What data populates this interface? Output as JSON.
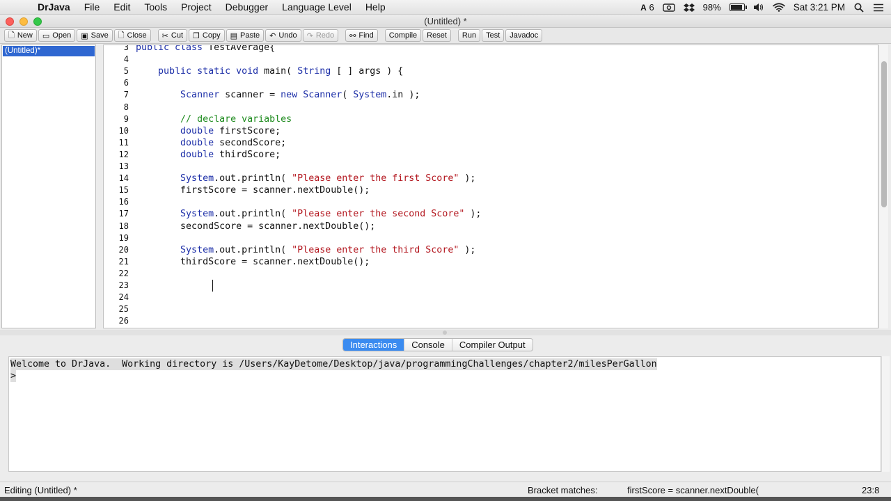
{
  "menubar": {
    "app_name": "DrJava",
    "menus": [
      "File",
      "Edit",
      "Tools",
      "Project",
      "Debugger",
      "Language Level",
      "Help"
    ],
    "status": {
      "adobe_count": "6",
      "battery_percent": "98%",
      "battery_level": 0.98,
      "clock": "Sat 3:21 PM"
    }
  },
  "window": {
    "title": "(Untitled) *"
  },
  "toolbar": {
    "buttons": [
      {
        "label": "New",
        "icon": "new-file-icon"
      },
      {
        "label": "Open",
        "icon": "open-folder-icon"
      },
      {
        "label": "Save",
        "icon": "save-disk-icon"
      },
      {
        "label": "Close",
        "icon": "close-doc-icon"
      },
      {
        "label": "Cut",
        "icon": "scissors-icon"
      },
      {
        "label": "Copy",
        "icon": "copy-icon"
      },
      {
        "label": "Paste",
        "icon": "clipboard-icon"
      },
      {
        "label": "Undo",
        "icon": "undo-icon"
      },
      {
        "label": "Redo",
        "icon": "redo-icon"
      },
      {
        "label": "Find",
        "icon": "binoculars-icon"
      },
      {
        "label": "Compile"
      },
      {
        "label": "Reset"
      },
      {
        "label": "Run"
      },
      {
        "label": "Test"
      },
      {
        "label": "Javadoc"
      }
    ]
  },
  "documents": [
    {
      "name": "(Untitled)*",
      "selected": true
    }
  ],
  "editor": {
    "lines": [
      {
        "n": "3",
        "segs": [
          [
            "kw",
            "public class "
          ],
          [
            "",
            "TestAverage{"
          ]
        ]
      },
      {
        "n": "4",
        "segs": []
      },
      {
        "n": "5",
        "segs": [
          [
            "",
            "    "
          ],
          [
            "kw",
            "public static void "
          ],
          [
            "",
            "main( "
          ],
          [
            "ty",
            "String"
          ],
          [
            "",
            " [ ] args ) {"
          ]
        ]
      },
      {
        "n": "6",
        "segs": []
      },
      {
        "n": "7",
        "segs": [
          [
            "",
            "        "
          ],
          [
            "ty",
            "Scanner"
          ],
          [
            "",
            " scanner = "
          ],
          [
            "kw",
            "new "
          ],
          [
            "ty",
            "Scanner"
          ],
          [
            "",
            "( "
          ],
          [
            "ty",
            "System"
          ],
          [
            "",
            ".in );"
          ]
        ]
      },
      {
        "n": "8",
        "segs": []
      },
      {
        "n": "9",
        "segs": [
          [
            "",
            "        "
          ],
          [
            "cmt",
            "// declare variables"
          ]
        ]
      },
      {
        "n": "10",
        "segs": [
          [
            "",
            "        "
          ],
          [
            "kw",
            "double "
          ],
          [
            "",
            "firstScore;"
          ]
        ]
      },
      {
        "n": "11",
        "segs": [
          [
            "",
            "        "
          ],
          [
            "kw",
            "double "
          ],
          [
            "",
            "secondScore;"
          ]
        ]
      },
      {
        "n": "12",
        "segs": [
          [
            "",
            "        "
          ],
          [
            "kw",
            "double "
          ],
          [
            "",
            "thirdScore;"
          ]
        ]
      },
      {
        "n": "13",
        "segs": []
      },
      {
        "n": "14",
        "segs": [
          [
            "",
            "        "
          ],
          [
            "ty",
            "System"
          ],
          [
            "",
            ".out.println( "
          ],
          [
            "str",
            "\"Please enter the first Score\""
          ],
          [
            "",
            " );"
          ]
        ]
      },
      {
        "n": "15",
        "segs": [
          [
            "",
            "        firstScore = scanner.nextDouble();"
          ]
        ]
      },
      {
        "n": "16",
        "segs": []
      },
      {
        "n": "17",
        "segs": [
          [
            "",
            "        "
          ],
          [
            "ty",
            "System"
          ],
          [
            "",
            ".out.println( "
          ],
          [
            "str",
            "\"Please enter the second Score\""
          ],
          [
            "",
            " );"
          ]
        ]
      },
      {
        "n": "18",
        "segs": [
          [
            "",
            "        secondScore = scanner.nextDouble();"
          ]
        ]
      },
      {
        "n": "19",
        "segs": []
      },
      {
        "n": "20",
        "segs": [
          [
            "",
            "        "
          ],
          [
            "ty",
            "System"
          ],
          [
            "",
            ".out.println( "
          ],
          [
            "str",
            "\"Please enter the third Score\""
          ],
          [
            "",
            " );"
          ]
        ]
      },
      {
        "n": "21",
        "segs": [
          [
            "",
            "        thirdScore = scanner.nextDouble();"
          ]
        ]
      },
      {
        "n": "22",
        "segs": []
      },
      {
        "n": "23",
        "segs": []
      },
      {
        "n": "24",
        "segs": []
      },
      {
        "n": "25",
        "segs": []
      },
      {
        "n": "26",
        "segs": []
      }
    ]
  },
  "bottom_tabs": [
    {
      "label": "Interactions",
      "active": true
    },
    {
      "label": "Console",
      "active": false
    },
    {
      "label": "Compiler Output",
      "active": false
    }
  ],
  "interactions": {
    "welcome": "Welcome to DrJava.  Working directory is /Users/KayDetome/Desktop/java/programmingChallenges/chapter2/milesPerGallon",
    "prompt": ">"
  },
  "statusbar": {
    "editing": "Editing (Untitled) *",
    "bracket_label": "Bracket matches:",
    "bracket_text": "firstScore = scanner.nextDouble(",
    "position": "23:8"
  }
}
